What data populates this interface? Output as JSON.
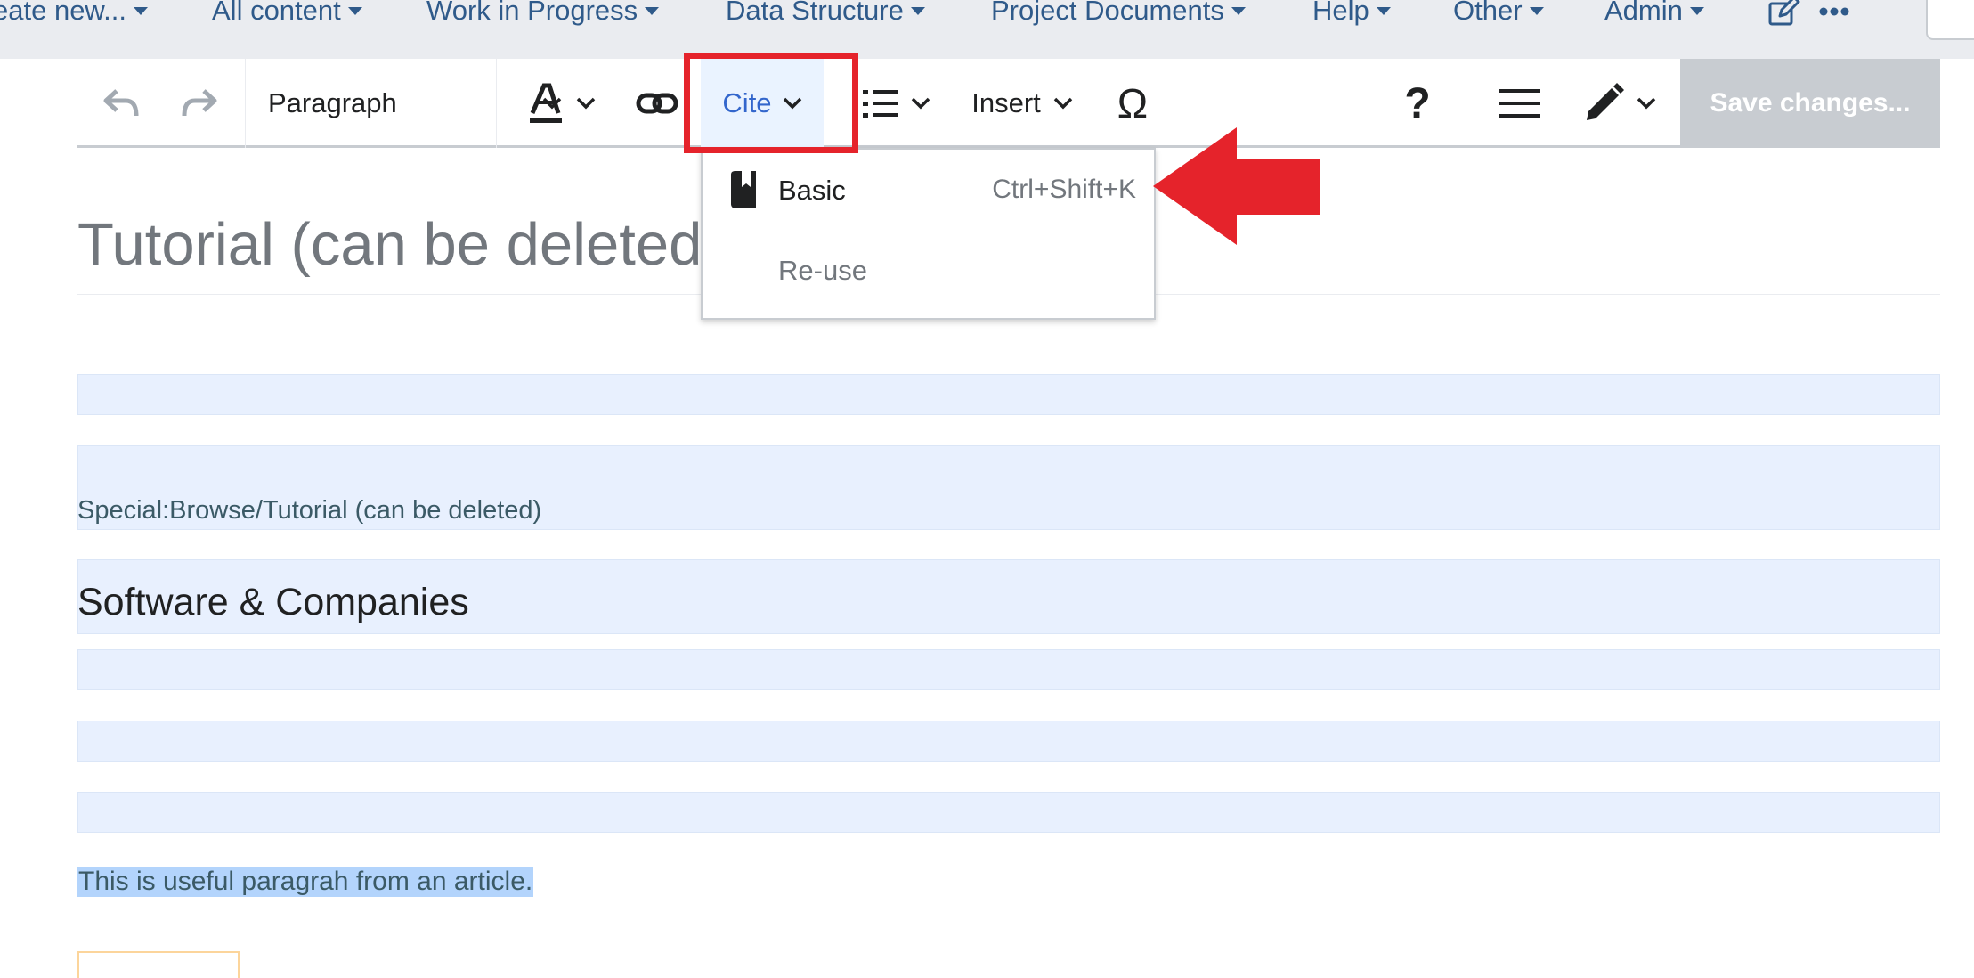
{
  "topnav": {
    "items": [
      {
        "label": "eate new..."
      },
      {
        "label": "All content"
      },
      {
        "label": "Work in Progress"
      },
      {
        "label": "Data Structure"
      },
      {
        "label": "Project Documents"
      },
      {
        "label": "Help"
      },
      {
        "label": "Other"
      },
      {
        "label": "Admin"
      }
    ]
  },
  "toolbar": {
    "paragraph_label": "Paragraph",
    "cite_label": "Cite",
    "insert_label": "Insert",
    "special_char": "Ω",
    "help_glyph": "?",
    "save_label": "Save changes..."
  },
  "cite_menu": {
    "items": [
      {
        "label": "Basic",
        "shortcut": "Ctrl+Shift+K",
        "icon": "book-icon"
      },
      {
        "label": "Re-use",
        "shortcut": "",
        "icon": ""
      }
    ]
  },
  "content": {
    "title": "Tutorial (can be deleted)",
    "browse_link": "Special:Browse/Tutorial (can be deleted)",
    "section_heading": "Software & Companies",
    "selected_paragraph": "This is useful paragrah from an article."
  },
  "colors": {
    "link": "#2f5a8a",
    "accent": "#3366cc",
    "highlight_border": "#e5232b",
    "block_bg": "#e8f0fe",
    "selection": "#b3d4fc"
  }
}
